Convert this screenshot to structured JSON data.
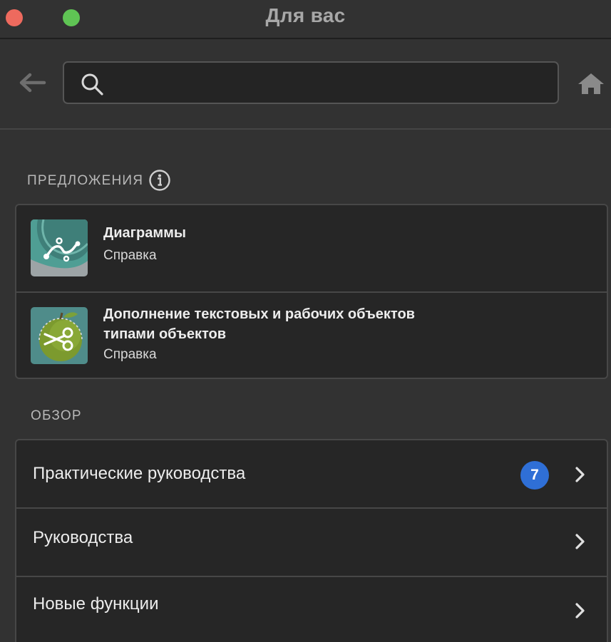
{
  "window": {
    "title": "Для вас"
  },
  "toolbar": {
    "search_value": "",
    "search_placeholder": ""
  },
  "suggestions": {
    "heading": "ПРЕДЛОЖЕНИЯ",
    "items": [
      {
        "title": "Диаграммы",
        "subtitle": "Справка",
        "icon": "graph-thumbnail"
      },
      {
        "title": "Дополнение текстовых и рабочих объектов типами объектов",
        "subtitle": "Справка",
        "icon": "apple-scissors-thumbnail"
      }
    ]
  },
  "browse": {
    "heading": "ОБЗОР",
    "items": [
      {
        "label": "Практические руководства",
        "badge": "7"
      },
      {
        "label": "Руководства"
      },
      {
        "label": "Новые функции"
      }
    ]
  },
  "colors": {
    "background": "#323232",
    "card": "#262626",
    "badge": "#2f6fd6",
    "close_button": "#ee6a5e",
    "maximize_button": "#5fc454"
  }
}
